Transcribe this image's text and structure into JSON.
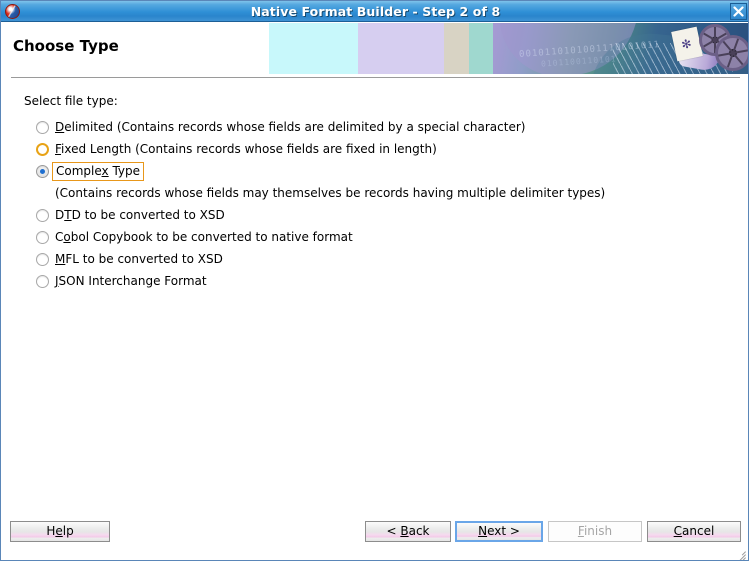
{
  "window": {
    "title": "Native Format Builder - Step 2 of 8",
    "app_icon": "oracle-logo-icon",
    "close_icon": "close-icon"
  },
  "header": {
    "title": "Choose Type",
    "banner_art": {
      "binary_line_1": "0010110101001110L01011",
      "binary_line_2": "0101100110101",
      "page_glyph": "✻",
      "bands": [
        "#c8f8fb",
        "#d6cef0",
        "#d8d3c4",
        "#9fd8cf"
      ]
    }
  },
  "content": {
    "section_label": "Select file type:",
    "options": [
      {
        "id": "delimited",
        "label_before": "",
        "mnemonic": "D",
        "label_after": "elimited (Contains records whose fields are delimited by a special character)",
        "state": "unchecked"
      },
      {
        "id": "fixed-length",
        "label_before": "",
        "mnemonic": "F",
        "label_after": "ixed Length (Contains records whose fields are fixed in length)",
        "state": "hover"
      },
      {
        "id": "complex-type",
        "label_before": "Comple",
        "mnemonic": "x",
        "label_after": " Type",
        "state": "checked",
        "focused": true,
        "description": "(Contains records whose fields may themselves be records having multiple delimiter types)"
      },
      {
        "id": "dtd-to-xsd",
        "label_before": "D",
        "mnemonic": "T",
        "label_after": "D to be converted to XSD",
        "state": "unchecked"
      },
      {
        "id": "cobol-copybook",
        "label_before": "C",
        "mnemonic": "o",
        "label_after": "bol Copybook to be converted to native format",
        "state": "unchecked"
      },
      {
        "id": "mfl-to-xsd",
        "label_before": "",
        "mnemonic": "M",
        "label_after": "FL to be converted to XSD",
        "state": "unchecked"
      },
      {
        "id": "json-interchange",
        "label_before": "",
        "mnemonic": "J",
        "label_after": "SON Interchange Format",
        "state": "unchecked"
      }
    ]
  },
  "buttons": {
    "help": {
      "before": "H",
      "mnemonic": "e",
      "after": "lp",
      "state": "enabled"
    },
    "back": {
      "before": "< ",
      "mnemonic": "B",
      "after": "ack",
      "state": "enabled"
    },
    "next": {
      "before": "",
      "mnemonic": "N",
      "after": "ext >",
      "state": "focused"
    },
    "finish": {
      "before": "",
      "mnemonic": "F",
      "after": "inish",
      "state": "disabled"
    },
    "cancel": {
      "before": "",
      "mnemonic": "C",
      "after": "ancel",
      "state": "enabled"
    }
  },
  "colors": {
    "titlebar_blue": "#2f8fd6",
    "focus_orange": "#e8971a",
    "hover_orange": "#e8a317",
    "radio_dot_blue": "#1f6fd0",
    "focus_border_blue": "#6aa6e8"
  }
}
